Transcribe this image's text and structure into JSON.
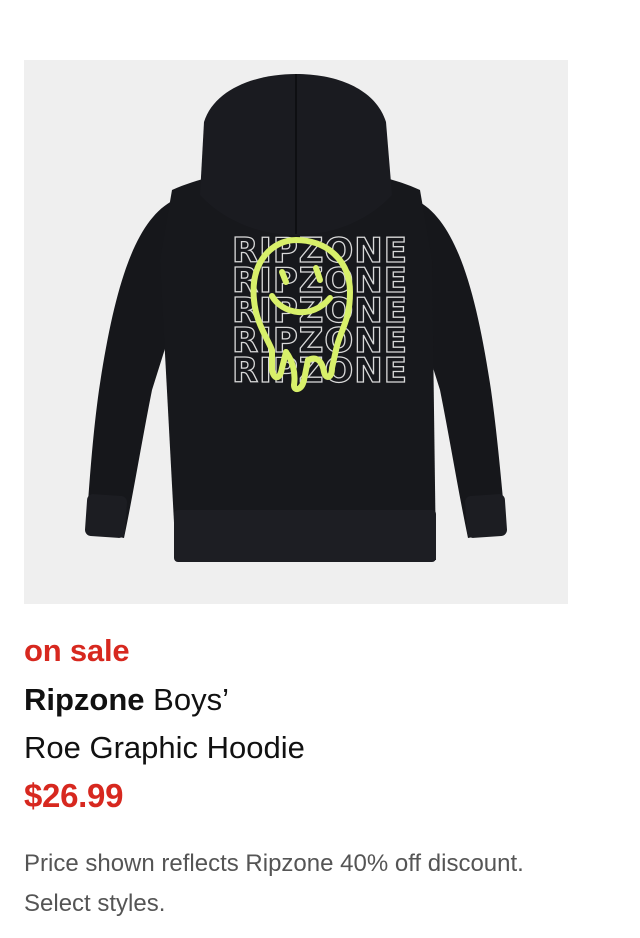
{
  "product": {
    "image_alt": "Ripzone Boys' Roe Graphic Hoodie",
    "image_graphic_text": "RIPZONE",
    "badge": "on sale",
    "brand": "Ripzone",
    "title_rest_line1": " Boys’",
    "title_line2": "Roe Graphic Hoodie",
    "price": "$26.99",
    "promo_note": "Price shown reflects Ripzone 40% off discount. Select styles."
  },
  "colors": {
    "sale_red": "#d7281f",
    "text": "#111111",
    "muted": "#555555",
    "image_bg": "#efefef",
    "hoodie": "#15161a",
    "graphic_neon": "#d8f06a"
  }
}
